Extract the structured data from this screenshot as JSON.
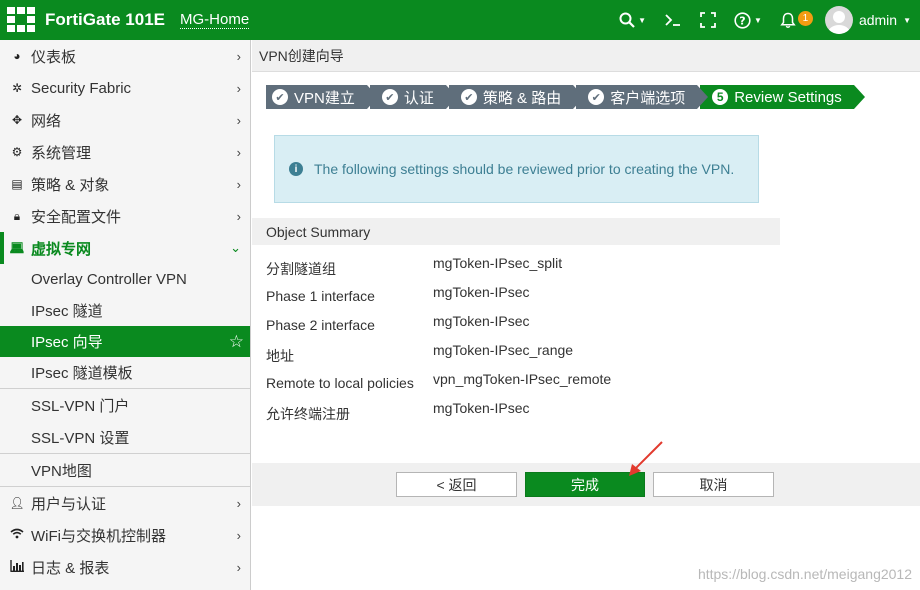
{
  "topbar": {
    "brand": "FortiGate 101E",
    "hostname": "MG-Home",
    "notification_count": "1",
    "username": "admin"
  },
  "sidebar": {
    "items": [
      {
        "label": "仪表板",
        "icon": "dashboard-icon"
      },
      {
        "label": "Security Fabric",
        "icon": "fabric-icon"
      },
      {
        "label": "网络",
        "icon": "network-arrows-icon"
      },
      {
        "label": "系统管理",
        "icon": "gear-icon"
      },
      {
        "label": "策略 & 对象",
        "icon": "document-icon"
      },
      {
        "label": "安全配置文件",
        "icon": "lock-icon"
      },
      {
        "label": "虚拟专网",
        "icon": "laptop-icon"
      }
    ],
    "vpn_sub": [
      "Overlay Controller VPN",
      "IPsec 隧道",
      "IPsec 向导",
      "IPsec 隧道模板",
      "SSL-VPN 门户",
      "SSL-VPN 设置",
      "VPN地图"
    ],
    "bottom_items": [
      {
        "label": "用户与认证",
        "icon": "user-icon"
      },
      {
        "label": "WiFi与交换机控制器",
        "icon": "wifi-icon"
      },
      {
        "label": "日志 & 报表",
        "icon": "bar-chart-icon"
      }
    ]
  },
  "main": {
    "page_title": "VPN创建向导",
    "steps": [
      {
        "label": "VPN建立",
        "status": "done"
      },
      {
        "label": "认证",
        "status": "done"
      },
      {
        "label": "策略 & 路由",
        "status": "done"
      },
      {
        "label": "客户端选项",
        "status": "done"
      },
      {
        "label": "Review Settings",
        "status": "current",
        "number": "5"
      }
    ],
    "info_message": "The following settings should be reviewed prior to creating the VPN.",
    "summary_title": "Object Summary",
    "summary_rows": [
      {
        "key": "分割隧道组",
        "value": "mgToken-IPsec_split"
      },
      {
        "key": "Phase 1 interface",
        "value": "mgToken-IPsec"
      },
      {
        "key": "Phase 2 interface",
        "value": "mgToken-IPsec"
      },
      {
        "key": "地址",
        "value": "mgToken-IPsec_range"
      },
      {
        "key": "Remote to local policies",
        "value": "vpn_mgToken-IPsec_remote"
      },
      {
        "key": "允许终端注册",
        "value": "mgToken-IPsec"
      }
    ],
    "buttons": {
      "back": "< 返回",
      "finish": "完成",
      "cancel": "取消"
    }
  },
  "watermark": "https://blog.csdn.net/meigang2012",
  "colors": {
    "brand_green": "#0a8a1f",
    "step_done": "#5f6e7b",
    "info_bg": "#d9eef4",
    "annotation_arrow": "#e23a2e"
  }
}
